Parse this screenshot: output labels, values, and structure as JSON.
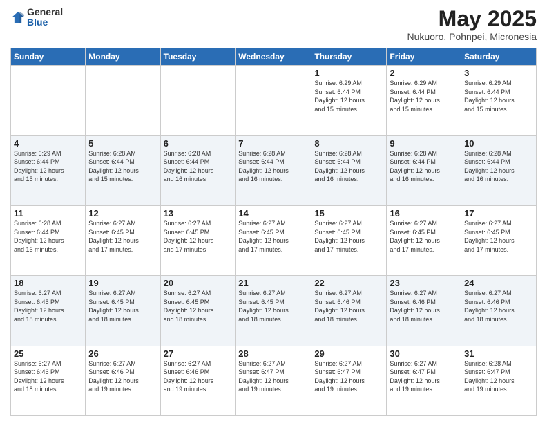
{
  "header": {
    "logo_general": "General",
    "logo_blue": "Blue",
    "month_year": "May 2025",
    "location": "Nukuoro, Pohnpei, Micronesia"
  },
  "days_of_week": [
    "Sunday",
    "Monday",
    "Tuesday",
    "Wednesday",
    "Thursday",
    "Friday",
    "Saturday"
  ],
  "weeks": [
    [
      {
        "day": "",
        "info": ""
      },
      {
        "day": "",
        "info": ""
      },
      {
        "day": "",
        "info": ""
      },
      {
        "day": "",
        "info": ""
      },
      {
        "day": "1",
        "info": "Sunrise: 6:29 AM\nSunset: 6:44 PM\nDaylight: 12 hours\nand 15 minutes."
      },
      {
        "day": "2",
        "info": "Sunrise: 6:29 AM\nSunset: 6:44 PM\nDaylight: 12 hours\nand 15 minutes."
      },
      {
        "day": "3",
        "info": "Sunrise: 6:29 AM\nSunset: 6:44 PM\nDaylight: 12 hours\nand 15 minutes."
      }
    ],
    [
      {
        "day": "4",
        "info": "Sunrise: 6:29 AM\nSunset: 6:44 PM\nDaylight: 12 hours\nand 15 minutes."
      },
      {
        "day": "5",
        "info": "Sunrise: 6:28 AM\nSunset: 6:44 PM\nDaylight: 12 hours\nand 15 minutes."
      },
      {
        "day": "6",
        "info": "Sunrise: 6:28 AM\nSunset: 6:44 PM\nDaylight: 12 hours\nand 16 minutes."
      },
      {
        "day": "7",
        "info": "Sunrise: 6:28 AM\nSunset: 6:44 PM\nDaylight: 12 hours\nand 16 minutes."
      },
      {
        "day": "8",
        "info": "Sunrise: 6:28 AM\nSunset: 6:44 PM\nDaylight: 12 hours\nand 16 minutes."
      },
      {
        "day": "9",
        "info": "Sunrise: 6:28 AM\nSunset: 6:44 PM\nDaylight: 12 hours\nand 16 minutes."
      },
      {
        "day": "10",
        "info": "Sunrise: 6:28 AM\nSunset: 6:44 PM\nDaylight: 12 hours\nand 16 minutes."
      }
    ],
    [
      {
        "day": "11",
        "info": "Sunrise: 6:28 AM\nSunset: 6:44 PM\nDaylight: 12 hours\nand 16 minutes."
      },
      {
        "day": "12",
        "info": "Sunrise: 6:27 AM\nSunset: 6:45 PM\nDaylight: 12 hours\nand 17 minutes."
      },
      {
        "day": "13",
        "info": "Sunrise: 6:27 AM\nSunset: 6:45 PM\nDaylight: 12 hours\nand 17 minutes."
      },
      {
        "day": "14",
        "info": "Sunrise: 6:27 AM\nSunset: 6:45 PM\nDaylight: 12 hours\nand 17 minutes."
      },
      {
        "day": "15",
        "info": "Sunrise: 6:27 AM\nSunset: 6:45 PM\nDaylight: 12 hours\nand 17 minutes."
      },
      {
        "day": "16",
        "info": "Sunrise: 6:27 AM\nSunset: 6:45 PM\nDaylight: 12 hours\nand 17 minutes."
      },
      {
        "day": "17",
        "info": "Sunrise: 6:27 AM\nSunset: 6:45 PM\nDaylight: 12 hours\nand 17 minutes."
      }
    ],
    [
      {
        "day": "18",
        "info": "Sunrise: 6:27 AM\nSunset: 6:45 PM\nDaylight: 12 hours\nand 18 minutes."
      },
      {
        "day": "19",
        "info": "Sunrise: 6:27 AM\nSunset: 6:45 PM\nDaylight: 12 hours\nand 18 minutes."
      },
      {
        "day": "20",
        "info": "Sunrise: 6:27 AM\nSunset: 6:45 PM\nDaylight: 12 hours\nand 18 minutes."
      },
      {
        "day": "21",
        "info": "Sunrise: 6:27 AM\nSunset: 6:45 PM\nDaylight: 12 hours\nand 18 minutes."
      },
      {
        "day": "22",
        "info": "Sunrise: 6:27 AM\nSunset: 6:46 PM\nDaylight: 12 hours\nand 18 minutes."
      },
      {
        "day": "23",
        "info": "Sunrise: 6:27 AM\nSunset: 6:46 PM\nDaylight: 12 hours\nand 18 minutes."
      },
      {
        "day": "24",
        "info": "Sunrise: 6:27 AM\nSunset: 6:46 PM\nDaylight: 12 hours\nand 18 minutes."
      }
    ],
    [
      {
        "day": "25",
        "info": "Sunrise: 6:27 AM\nSunset: 6:46 PM\nDaylight: 12 hours\nand 18 minutes."
      },
      {
        "day": "26",
        "info": "Sunrise: 6:27 AM\nSunset: 6:46 PM\nDaylight: 12 hours\nand 19 minutes."
      },
      {
        "day": "27",
        "info": "Sunrise: 6:27 AM\nSunset: 6:46 PM\nDaylight: 12 hours\nand 19 minutes."
      },
      {
        "day": "28",
        "info": "Sunrise: 6:27 AM\nSunset: 6:47 PM\nDaylight: 12 hours\nand 19 minutes."
      },
      {
        "day": "29",
        "info": "Sunrise: 6:27 AM\nSunset: 6:47 PM\nDaylight: 12 hours\nand 19 minutes."
      },
      {
        "day": "30",
        "info": "Sunrise: 6:27 AM\nSunset: 6:47 PM\nDaylight: 12 hours\nand 19 minutes."
      },
      {
        "day": "31",
        "info": "Sunrise: 6:28 AM\nSunset: 6:47 PM\nDaylight: 12 hours\nand 19 minutes."
      }
    ]
  ]
}
